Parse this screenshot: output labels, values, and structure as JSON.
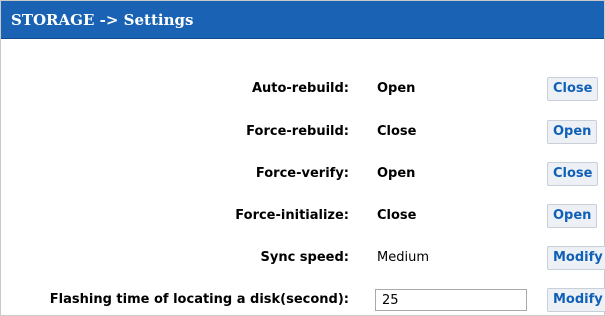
{
  "header": {
    "title": "STORAGE -> Settings"
  },
  "colors": {
    "header_bg": "#1a63b4",
    "button_text": "#1060b8"
  },
  "settings": [
    {
      "label": "Auto-rebuild:",
      "value": "Open",
      "button": "Close"
    },
    {
      "label": "Force-rebuild:",
      "value": "Close",
      "button": "Open"
    },
    {
      "label": "Force-verify:",
      "value": "Open",
      "button": "Close"
    },
    {
      "label": "Force-initialize:",
      "value": "Close",
      "button": "Open"
    },
    {
      "label": "Sync speed:",
      "value": "Medium",
      "button": "Modify"
    },
    {
      "label": "Flashing time of locating a disk(second):",
      "input_value": "25",
      "button": "Modify"
    }
  ]
}
